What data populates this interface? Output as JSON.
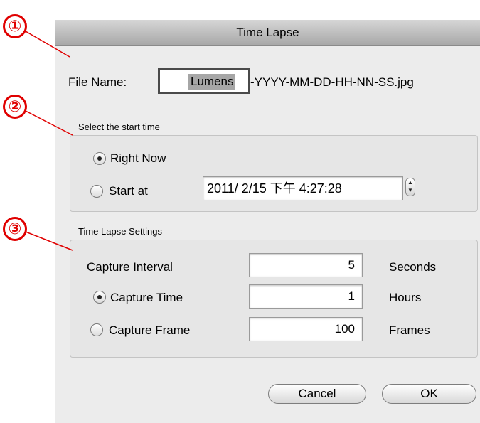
{
  "annotations": [
    "①",
    "②",
    "③"
  ],
  "window": {
    "title": "Time Lapse"
  },
  "file_name": {
    "label": "File Name:",
    "value": "Lumens",
    "suffix": "-YYYY-MM-DD-HH-NN-SS.jpg"
  },
  "start_time": {
    "group_label": "Select the start time",
    "right_now_label": "Right Now",
    "start_at_label": "Start at",
    "datetime_value": "2011/  2/15 下午   4:27:28",
    "selected": "Right Now"
  },
  "settings": {
    "group_label": "Time Lapse Settings",
    "capture_interval_label": "Capture Interval",
    "capture_interval_value": "5",
    "capture_interval_unit": "Seconds",
    "capture_time_label": "Capture Time",
    "capture_time_value": "1",
    "capture_time_unit": "Hours",
    "capture_frame_label": "Capture Frame",
    "capture_frame_value": "100",
    "capture_frame_unit": "Frames",
    "selected": "Capture Time"
  },
  "buttons": {
    "cancel": "Cancel",
    "ok": "OK"
  },
  "colors": {
    "annotation": "#e00000",
    "selection": "#a6a6a6"
  }
}
